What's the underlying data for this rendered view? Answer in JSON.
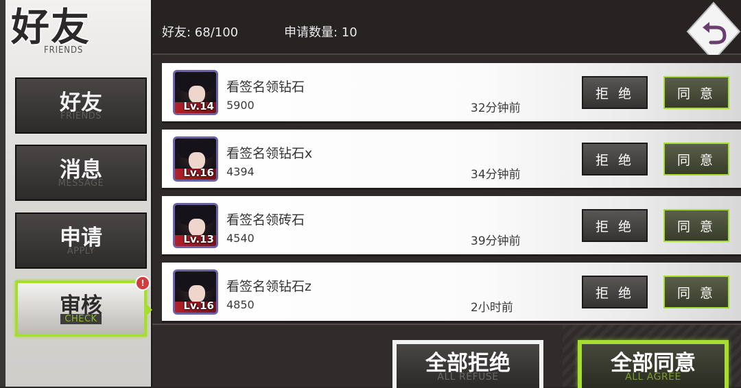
{
  "page": {
    "title": "好友",
    "subtitle": "FRIENDS"
  },
  "colors": {
    "accent": "#a6de2f",
    "dark_panel": "#2a2726",
    "badge": "#d43b3b"
  },
  "nav": {
    "items": [
      {
        "label": "好友",
        "sub": "FRIENDS",
        "active": false
      },
      {
        "label": "消息",
        "sub": "MESSAGE",
        "active": false
      },
      {
        "label": "申请",
        "sub": "APPLY",
        "active": false
      },
      {
        "label": "审核",
        "sub": "CHECK",
        "active": true,
        "badge": "!"
      }
    ]
  },
  "header": {
    "friends_label": "好友: 68/100",
    "requests_label": "申请数量: 10",
    "back_icon": "undo-arrow-icon"
  },
  "requests": [
    {
      "name": "看签名领钻石",
      "id": "5900",
      "time": "32分钟前",
      "level": "Lv.14"
    },
    {
      "name": "看签名领钻石x",
      "id": "4394",
      "time": "34分钟前",
      "level": "Lv.16"
    },
    {
      "name": "看签名领砖石",
      "id": "4540",
      "time": "39分钟前",
      "level": "Lv.13"
    },
    {
      "name": "看签名领钻石z",
      "id": "4850",
      "time": "2小时前",
      "level": "Lv.16"
    }
  ],
  "row_buttons": {
    "refuse": "拒 绝",
    "agree": "同 意"
  },
  "bottom": {
    "refuse_all": "全部拒绝",
    "refuse_all_sub": "ALL REFUSE",
    "agree_all": "全部同意",
    "agree_all_sub": "ALL AGREE"
  }
}
